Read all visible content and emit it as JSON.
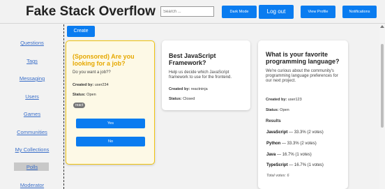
{
  "header": {
    "brand": "Fake Stack Overflow",
    "search_placeholder": "Search ...",
    "dark_mode": "Dark Mode",
    "logout": "Log out",
    "view_profile": "View Profile",
    "notifications": "Notifications"
  },
  "sidebar": {
    "items": [
      {
        "label": "Questions"
      },
      {
        "label": "Tags"
      },
      {
        "label": "Messaging"
      },
      {
        "label": "Users"
      },
      {
        "label": "Games"
      },
      {
        "label": "Communities"
      },
      {
        "label": "My Collections"
      },
      {
        "label": "Polls"
      },
      {
        "label": "Moderator"
      }
    ],
    "active": "Polls"
  },
  "main": {
    "create_label": "Create",
    "polls": [
      {
        "title": "(Sponsored) Are you looking for a job?",
        "description": "Do you want a job??",
        "created_by_label": "Created by:",
        "created_by": "user234",
        "status_label": "Status:",
        "status": "Open",
        "tag": "react",
        "options": [
          "Yes",
          "No"
        ]
      },
      {
        "title": "Best JavaScript Framework?",
        "description": "Help us decide which JavaScript framework to use for the frontend.",
        "created_by_label": "Created by:",
        "created_by": "reactninja",
        "status_label": "Status:",
        "status": "Closed"
      },
      {
        "title": "What is your favorite programming language?",
        "description": "We're curious about the community's programming language preferences for our next project.",
        "created_by_label": "Created by:",
        "created_by": "user123",
        "status_label": "Status:",
        "status": "Open",
        "results_label": "Results",
        "results": [
          {
            "name": "JavaScript",
            "text": " — 33.3% (2 votes)"
          },
          {
            "name": "Python",
            "text": " — 33.3% (2 votes)"
          },
          {
            "name": "Java",
            "text": " — 16.7% (1 votes)"
          },
          {
            "name": "TypeScript",
            "text": " — 16.7% (1 votes)"
          }
        ],
        "total": "Total votes: 6"
      }
    ]
  },
  "colors": {
    "accent": "#0a7cf0",
    "sponsored_border": "#f1c40f",
    "sponsored_title": "#e6a800",
    "link": "#3b6fc9"
  }
}
